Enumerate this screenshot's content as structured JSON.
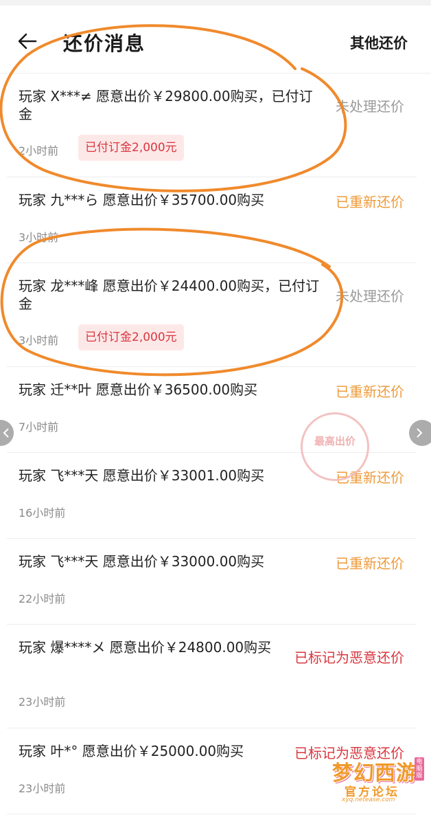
{
  "header": {
    "title": "还价消息",
    "action_label": "其他还价",
    "back_icon": "arrow-left-icon"
  },
  "offers": [
    {
      "text": "玩家 X***≠ 愿意出价￥29800.00购买，已付订金",
      "time": "2小时前",
      "badge": "已付订金2,000元",
      "status": "未处理还价",
      "status_color": "#9a9a9a"
    },
    {
      "text": "玩家 九***ら 愿意出价￥35700.00购买",
      "time": "3小时前",
      "badge": "",
      "status": "已重新还价",
      "status_color": "#ef9a3a"
    },
    {
      "text": "玩家 龙***峰 愿意出价￥24400.00购买，已付订金",
      "time": "3小时前",
      "badge": "已付订金2,000元",
      "status": "未处理还价",
      "status_color": "#9a9a9a"
    },
    {
      "text": "玩家 迁**叶 愿意出价￥36500.00购买",
      "time": "7小时前",
      "badge": "",
      "status": "已重新还价",
      "status_color": "#ef9a3a"
    },
    {
      "text": "玩家 飞***天 愿意出价￥33001.00购买",
      "time": "16小时前",
      "badge": "",
      "status": "已重新还价",
      "status_color": "#ef9a3a"
    },
    {
      "text": "玩家 飞***天 愿意出价￥33000.00购买",
      "time": "22小时前",
      "badge": "",
      "status": "已重新还价",
      "status_color": "#ef9a3a"
    },
    {
      "text": "玩家 爆****メ 愿意出价￥24800.00购买",
      "time": "23小时前",
      "badge": "",
      "status": "已标记为恶意还价",
      "status_color": "#d9363e"
    },
    {
      "text": "玩家 叶*° 愿意出价￥25000.00购买",
      "time": "23小时前",
      "badge": "",
      "status": "已标记为恶意还价",
      "status_color": "#d9363e"
    }
  ],
  "stamp": {
    "label": "最高出价"
  },
  "nav": {
    "prev_icon": "chevron-left-icon",
    "next_icon": "chevron-right-icon"
  },
  "watermark": {
    "title": "梦幻西游",
    "tag": "电脑版",
    "subtitle": "官方论坛",
    "url": "xyq.netease.com"
  },
  "annotation": {
    "color": "#f08a2c"
  }
}
